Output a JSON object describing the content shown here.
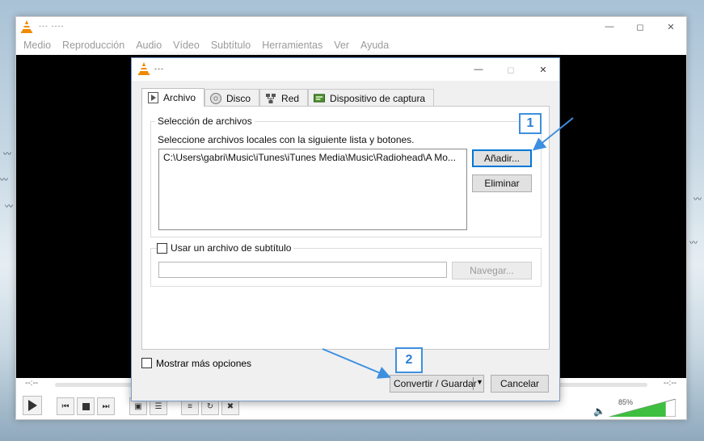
{
  "vlc": {
    "title": "--- ----",
    "menu": [
      "Medio",
      "Reproducción",
      "Audio",
      "Vídeo",
      "Subtítulo",
      "Herramientas",
      "Ver",
      "Ayuda"
    ],
    "time_elapsed": "--:--",
    "time_total": "--:--",
    "volume_percent": 85,
    "volume_label": "85%"
  },
  "dialog": {
    "title": "---",
    "tabs": [
      {
        "label": "Archivo",
        "icon": "file-play-icon",
        "active": true
      },
      {
        "label": "Disco",
        "icon": "disc-icon",
        "active": false
      },
      {
        "label": "Red",
        "icon": "network-icon",
        "active": false
      },
      {
        "label": "Dispositivo de captura",
        "icon": "capture-card-icon",
        "active": false
      }
    ],
    "file_selection": {
      "legend": "Selección de archivos",
      "description": "Seleccione archivos locales con la siguiente lista y botones.",
      "files": [
        "C:\\Users\\gabri\\Music\\iTunes\\iTunes Media\\Music\\Radiohead\\A Mo..."
      ],
      "add_label": "Añadir...",
      "remove_label": "Eliminar"
    },
    "subtitle": {
      "checkbox_label": "Usar un archivo de subtítulo",
      "checked": false,
      "path_value": "",
      "browse_label": "Navegar..."
    },
    "more_options_label": "Mostrar más opciones",
    "convert_label": "Convertir / Guardar",
    "cancel_label": "Cancelar"
  },
  "annotations": {
    "step1": "1",
    "step2": "2",
    "color": "#3e8fe0"
  }
}
